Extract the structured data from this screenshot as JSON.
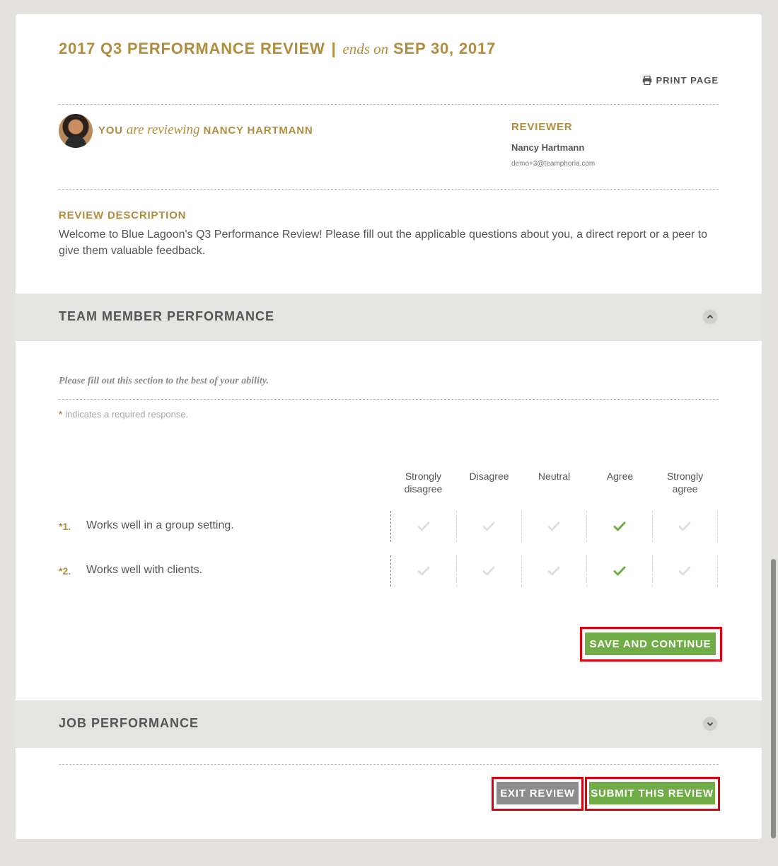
{
  "review": {
    "title": "2017 Q3 PERFORMANCE REVIEW",
    "separator": "|",
    "ends_on": "ends on",
    "end_date": "SEP 30, 2017",
    "print_label": "PRINT PAGE"
  },
  "reviewing": {
    "you": "YOU",
    "are_reviewing": "are reviewing",
    "reviewee": "NANCY HARTMANN"
  },
  "reviewer": {
    "label": "REVIEWER",
    "name": "Nancy Hartmann",
    "email": "demo+3@teamphoria.com"
  },
  "description": {
    "label": "REVIEW DESCRIPTION",
    "text": "Welcome to Blue Lagoon's Q3 Performance Review! Please fill out the applicable questions about you, a direct report or a peer to give them valuable feedback."
  },
  "sections": [
    {
      "title": "TEAM MEMBER PERFORMANCE",
      "expanded": true,
      "instructions": "Please fill out this section to the best of your ability.",
      "required_star": "*",
      "required_note": "indicates a required response.",
      "scale": [
        [
          "Strongly",
          "disagree"
        ],
        [
          "Disagree",
          ""
        ],
        [
          "Neutral",
          ""
        ],
        [
          "Agree",
          ""
        ],
        [
          "Strongly",
          "agree"
        ]
      ],
      "questions": [
        {
          "num": "*1.",
          "text": "Works well in a group setting.",
          "selected_index": 3
        },
        {
          "num": "*2.",
          "text": "Works well with clients.",
          "selected_index": 3
        }
      ],
      "save_label": "SAVE AND CONTINUE"
    },
    {
      "title": "JOB PERFORMANCE",
      "expanded": false
    }
  ],
  "footer": {
    "exit_label": "EXIT REVIEW",
    "submit_label": "SUBMIT THIS REVIEW"
  },
  "colors": {
    "gold": "#b18e3f",
    "green": "#70ad47",
    "gray_button": "#8c8c8c",
    "highlight": "#e0000d",
    "check_off": "#dcdcdc"
  }
}
